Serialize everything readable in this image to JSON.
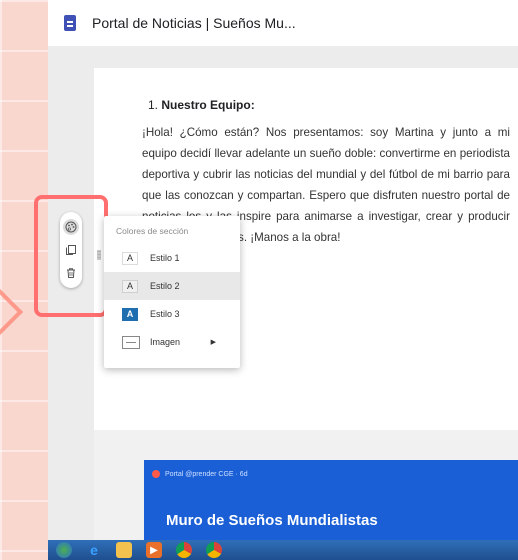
{
  "window": {
    "title": "Portal de Noticias | Sueños Mu..."
  },
  "document": {
    "section_number": "1.",
    "section_heading": "Nuestro Equipo:",
    "paragraph": "¡Hola! ¿Cómo están? Nos presentamos: soy Martina y junto a mi equipo decidí llevar adelante un sueño doble: convertirme en periodista deportiva y cubrir las noticias del mundial y del fútbol de mi barrio para que las conozcan y compartan. Espero que disfruten nuestro portal de noticias los y las inspire para animarse a investigar, crear y producir sus propias noticias. ¡Manos a la obra!"
  },
  "section_toolbar": {
    "buttons": [
      {
        "icon": "palette-icon"
      },
      {
        "icon": "copy-icon"
      },
      {
        "icon": "trash-icon"
      }
    ]
  },
  "color_menu": {
    "header": "Colores de sección",
    "items": [
      {
        "swatch": "A",
        "label": "Estilo 1",
        "selected": false
      },
      {
        "swatch": "A",
        "label": "Estilo 2",
        "selected": true
      },
      {
        "swatch": "A",
        "label": "Estilo 3",
        "selected": false
      },
      {
        "label": "Imagen",
        "has_submenu": true
      }
    ]
  },
  "banner": {
    "meta": "Portal @prender CGE · 6d",
    "title": "Muro de Sueños Mundialistas",
    "color": "#1a5fd6"
  },
  "taskbar": {
    "icons": [
      "windows-start-icon",
      "ie-icon",
      "explorer-icon",
      "media-icon",
      "chrome-icon",
      "chrome-alt-icon"
    ]
  },
  "colors": {
    "background": "#f9d7cf",
    "highlight": "#ff6f6f",
    "accent": "#3f51b5"
  }
}
